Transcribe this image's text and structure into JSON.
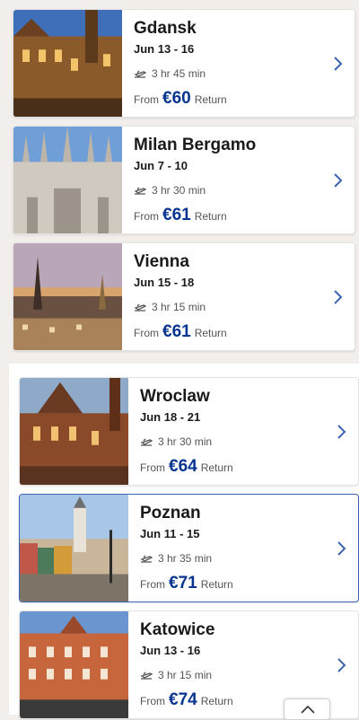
{
  "flights": [
    {
      "city": "Gdansk",
      "dates": "Jun 13 - 16",
      "duration": "3 hr 45 min",
      "from": "From",
      "price": "€60",
      "return": "Return"
    },
    {
      "city": "Milan Bergamo",
      "dates": "Jun 7 - 10",
      "duration": "3 hr 30 min",
      "from": "From",
      "price": "€61",
      "return": "Return"
    },
    {
      "city": "Vienna",
      "dates": "Jun 15 - 18",
      "duration": "3 hr 15 min",
      "from": "From",
      "price": "€61",
      "return": "Return"
    },
    {
      "city": "Wroclaw",
      "dates": "Jun 18 - 21",
      "duration": "3 hr 30 min",
      "from": "From",
      "price": "€64",
      "return": "Return"
    },
    {
      "city": "Poznan",
      "dates": "Jun 11 - 15",
      "duration": "3 hr 35 min",
      "from": "From",
      "price": "€71",
      "return": "Return"
    },
    {
      "city": "Katowice",
      "dates": "Jun 13 - 16",
      "duration": "3 hr 15 min",
      "from": "From",
      "price": "€74",
      "return": "Return"
    }
  ],
  "colors": {
    "price": "#073590",
    "chevron": "#3b63b0",
    "selected_border": "#3b63b0"
  },
  "icons": {
    "flight": "plane-departure-icon",
    "chevron": "chevron-right-icon",
    "scroll": "chevron-up-icon"
  }
}
